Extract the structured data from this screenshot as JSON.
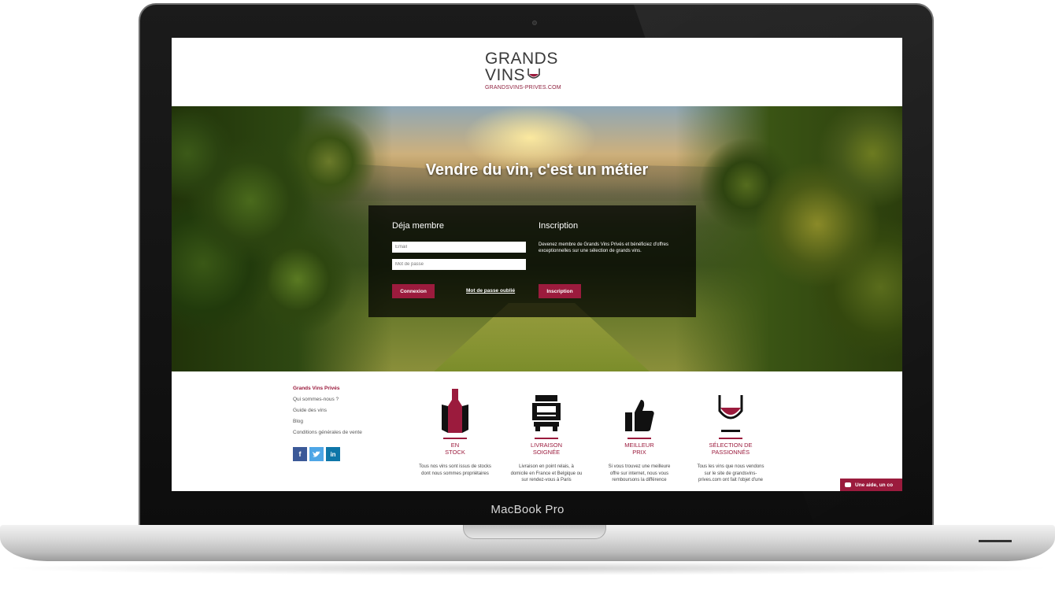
{
  "device": {
    "label": "MacBook Pro"
  },
  "header": {
    "logo_line1": "GRANDS",
    "logo_line2": "VINS",
    "logo_url": "GRANDSVINS-PRIVES.COM"
  },
  "hero": {
    "title": "Vendre du vin, c'est un métier"
  },
  "login": {
    "heading": "Déja membre",
    "email_placeholder": "Email",
    "password_placeholder": "Mot de passe",
    "login_button": "Connexion",
    "forgot_link": "Mot de passe oublié"
  },
  "signup": {
    "heading": "Inscription",
    "text": "Devenez membre de Grands Vins Privés et bénéficiez d'offres exceptionnelles sur une sélection de grands vins.",
    "button": "Inscription"
  },
  "footer_links": [
    "Grands Vins Privés",
    "Qui sommes-nous ?",
    "Guide des vins",
    "Blog",
    "Conditions générales de vente"
  ],
  "social": {
    "facebook": "f",
    "twitter": "t",
    "linkedin": "in"
  },
  "features": [
    {
      "icon": "wine-bottle-icon",
      "title_l1": "EN",
      "title_l2": "STOCK",
      "desc": "Tous nos vins sont issus de stocks dont nous sommes propriétaires"
    },
    {
      "icon": "truck-icon",
      "title_l1": "LIVRAISON",
      "title_l2": "SOIGNÉE",
      "desc": "Livraison en point relais, à domicile en France et Belgique ou sur rendez-vous à Paris"
    },
    {
      "icon": "thumbs-up-icon",
      "title_l1": "MEILLEUR",
      "title_l2": "PRIX",
      "desc": "Si vous trouvez une meilleure offre sur internet, nous vous remboursons la différence"
    },
    {
      "icon": "wine-glass-icon",
      "title_l1": "SÉLECTION DE",
      "title_l2": "PASSIONNÉS",
      "desc": "Tous les vins que nous vendons sur le site de grandsvins-prives.com ont fait l'objet d'une"
    }
  ],
  "chat": {
    "label": "Une aide, un co"
  },
  "colors": {
    "brand": "#9b1b3d",
    "panel": "#000000"
  }
}
